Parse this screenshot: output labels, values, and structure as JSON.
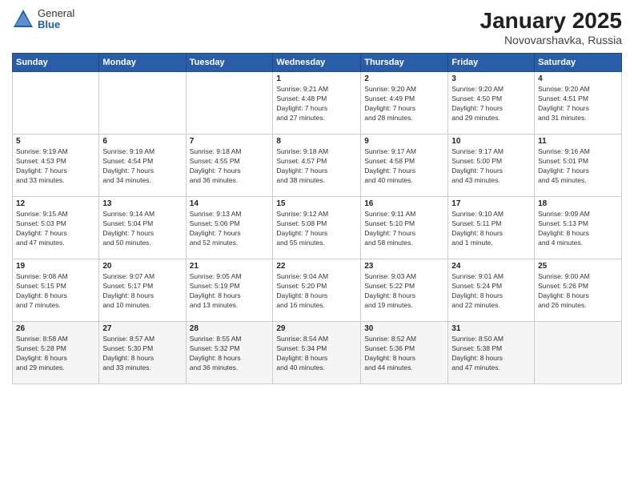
{
  "logo": {
    "general": "General",
    "blue": "Blue"
  },
  "title": "January 2025",
  "subtitle": "Novovarshavka, Russia",
  "days_header": [
    "Sunday",
    "Monday",
    "Tuesday",
    "Wednesday",
    "Thursday",
    "Friday",
    "Saturday"
  ],
  "weeks": [
    [
      {
        "day": "",
        "info": ""
      },
      {
        "day": "",
        "info": ""
      },
      {
        "day": "",
        "info": ""
      },
      {
        "day": "1",
        "info": "Sunrise: 9:21 AM\nSunset: 4:48 PM\nDaylight: 7 hours\nand 27 minutes."
      },
      {
        "day": "2",
        "info": "Sunrise: 9:20 AM\nSunset: 4:49 PM\nDaylight: 7 hours\nand 28 minutes."
      },
      {
        "day": "3",
        "info": "Sunrise: 9:20 AM\nSunset: 4:50 PM\nDaylight: 7 hours\nand 29 minutes."
      },
      {
        "day": "4",
        "info": "Sunrise: 9:20 AM\nSunset: 4:51 PM\nDaylight: 7 hours\nand 31 minutes."
      }
    ],
    [
      {
        "day": "5",
        "info": "Sunrise: 9:19 AM\nSunset: 4:53 PM\nDaylight: 7 hours\nand 33 minutes."
      },
      {
        "day": "6",
        "info": "Sunrise: 9:19 AM\nSunset: 4:54 PM\nDaylight: 7 hours\nand 34 minutes."
      },
      {
        "day": "7",
        "info": "Sunrise: 9:18 AM\nSunset: 4:55 PM\nDaylight: 7 hours\nand 36 minutes."
      },
      {
        "day": "8",
        "info": "Sunrise: 9:18 AM\nSunset: 4:57 PM\nDaylight: 7 hours\nand 38 minutes."
      },
      {
        "day": "9",
        "info": "Sunrise: 9:17 AM\nSunset: 4:58 PM\nDaylight: 7 hours\nand 40 minutes."
      },
      {
        "day": "10",
        "info": "Sunrise: 9:17 AM\nSunset: 5:00 PM\nDaylight: 7 hours\nand 43 minutes."
      },
      {
        "day": "11",
        "info": "Sunrise: 9:16 AM\nSunset: 5:01 PM\nDaylight: 7 hours\nand 45 minutes."
      }
    ],
    [
      {
        "day": "12",
        "info": "Sunrise: 9:15 AM\nSunset: 5:03 PM\nDaylight: 7 hours\nand 47 minutes."
      },
      {
        "day": "13",
        "info": "Sunrise: 9:14 AM\nSunset: 5:04 PM\nDaylight: 7 hours\nand 50 minutes."
      },
      {
        "day": "14",
        "info": "Sunrise: 9:13 AM\nSunset: 5:06 PM\nDaylight: 7 hours\nand 52 minutes."
      },
      {
        "day": "15",
        "info": "Sunrise: 9:12 AM\nSunset: 5:08 PM\nDaylight: 7 hours\nand 55 minutes."
      },
      {
        "day": "16",
        "info": "Sunrise: 9:11 AM\nSunset: 5:10 PM\nDaylight: 7 hours\nand 58 minutes."
      },
      {
        "day": "17",
        "info": "Sunrise: 9:10 AM\nSunset: 5:11 PM\nDaylight: 8 hours\nand 1 minute."
      },
      {
        "day": "18",
        "info": "Sunrise: 9:09 AM\nSunset: 5:13 PM\nDaylight: 8 hours\nand 4 minutes."
      }
    ],
    [
      {
        "day": "19",
        "info": "Sunrise: 9:08 AM\nSunset: 5:15 PM\nDaylight: 8 hours\nand 7 minutes."
      },
      {
        "day": "20",
        "info": "Sunrise: 9:07 AM\nSunset: 5:17 PM\nDaylight: 8 hours\nand 10 minutes."
      },
      {
        "day": "21",
        "info": "Sunrise: 9:05 AM\nSunset: 5:19 PM\nDaylight: 8 hours\nand 13 minutes."
      },
      {
        "day": "22",
        "info": "Sunrise: 9:04 AM\nSunset: 5:20 PM\nDaylight: 8 hours\nand 16 minutes."
      },
      {
        "day": "23",
        "info": "Sunrise: 9:03 AM\nSunset: 5:22 PM\nDaylight: 8 hours\nand 19 minutes."
      },
      {
        "day": "24",
        "info": "Sunrise: 9:01 AM\nSunset: 5:24 PM\nDaylight: 8 hours\nand 22 minutes."
      },
      {
        "day": "25",
        "info": "Sunrise: 9:00 AM\nSunset: 5:26 PM\nDaylight: 8 hours\nand 26 minutes."
      }
    ],
    [
      {
        "day": "26",
        "info": "Sunrise: 8:58 AM\nSunset: 5:28 PM\nDaylight: 8 hours\nand 29 minutes."
      },
      {
        "day": "27",
        "info": "Sunrise: 8:57 AM\nSunset: 5:30 PM\nDaylight: 8 hours\nand 33 minutes."
      },
      {
        "day": "28",
        "info": "Sunrise: 8:55 AM\nSunset: 5:32 PM\nDaylight: 8 hours\nand 36 minutes."
      },
      {
        "day": "29",
        "info": "Sunrise: 8:54 AM\nSunset: 5:34 PM\nDaylight: 8 hours\nand 40 minutes."
      },
      {
        "day": "30",
        "info": "Sunrise: 8:52 AM\nSunset: 5:36 PM\nDaylight: 8 hours\nand 44 minutes."
      },
      {
        "day": "31",
        "info": "Sunrise: 8:50 AM\nSunset: 5:38 PM\nDaylight: 8 hours\nand 47 minutes."
      },
      {
        "day": "",
        "info": ""
      }
    ]
  ]
}
